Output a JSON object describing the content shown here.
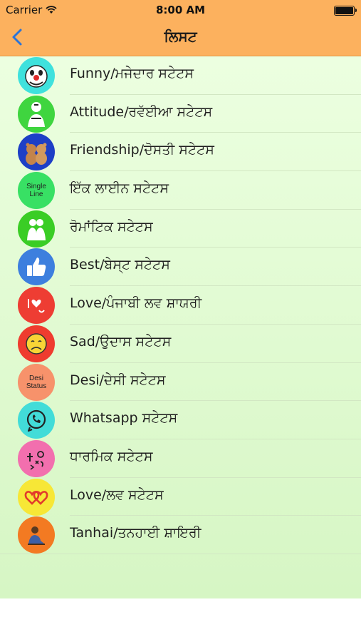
{
  "status_bar": {
    "carrier": "Carrier",
    "time": "8:00 AM"
  },
  "nav": {
    "title": "ਲਿਸਟ"
  },
  "items": [
    {
      "label": "Funny/ਮਜੇਦਾਰ ਸਟੇਟਸ",
      "icon": "funny-face-icon",
      "color": "#3fe1dd"
    },
    {
      "label": "Attitude/ਰਵੱਈਆ ਸਟੇਟਸ",
      "icon": "attitude-man-icon",
      "color": "#3fd53f"
    },
    {
      "label": "Friendship/ਦੋਸਤੀ ਸਟੇਟਸ",
      "icon": "teddy-bears-icon",
      "color": "#1d3fc6"
    },
    {
      "label": "ਇੱਕ ਲਾਈਨ ਸਟੇਟਸ",
      "icon": "single-line-icon",
      "icon_text": "Single Line",
      "color": "#38e064"
    },
    {
      "label": "ਰੋਮਾਂਟਿਕ ਸਟੇਟਸ",
      "icon": "romantic-couple-icon",
      "color": "#3acd25"
    },
    {
      "label": "Best/ਬੇਸ੍ਟ ਸਟੇਟਸ",
      "icon": "thumbs-up-icon",
      "color": "#3d7fde"
    },
    {
      "label": "Love/ਪੰਜਾਬੀ ਲਵ ਸ਼ਾਯਰੀ",
      "icon": "i-love-you-icon",
      "color": "#ee3d33"
    },
    {
      "label": "Sad/ਉਦਾਸ ਸਟੇਟਸ",
      "icon": "sad-face-icon",
      "color": "#ef3c2f"
    },
    {
      "label": "Desi/ਦੇਸੀ ਸਟੇਟਸ",
      "icon": "desi-status-icon",
      "icon_text": "Desi Status",
      "color": "#f7926b"
    },
    {
      "label": "Whatsapp ਸਟੇਟਸ",
      "icon": "whatsapp-icon",
      "color": "#42dcd8"
    },
    {
      "label": "ਧਾਰਮਿਕ ਸਟੇਟਸ",
      "icon": "religious-symbols-icon",
      "color": "#f26fae"
    },
    {
      "label": "Love/ਲਵ ਸਟੇਟਸ",
      "icon": "hearts-icon",
      "color": "#f7e736"
    },
    {
      "label": "Tanhai/ਤਨਹਾਈ ਸ਼ਾਇਰੀ",
      "icon": "lonely-person-icon",
      "color": "#f37a22"
    }
  ]
}
